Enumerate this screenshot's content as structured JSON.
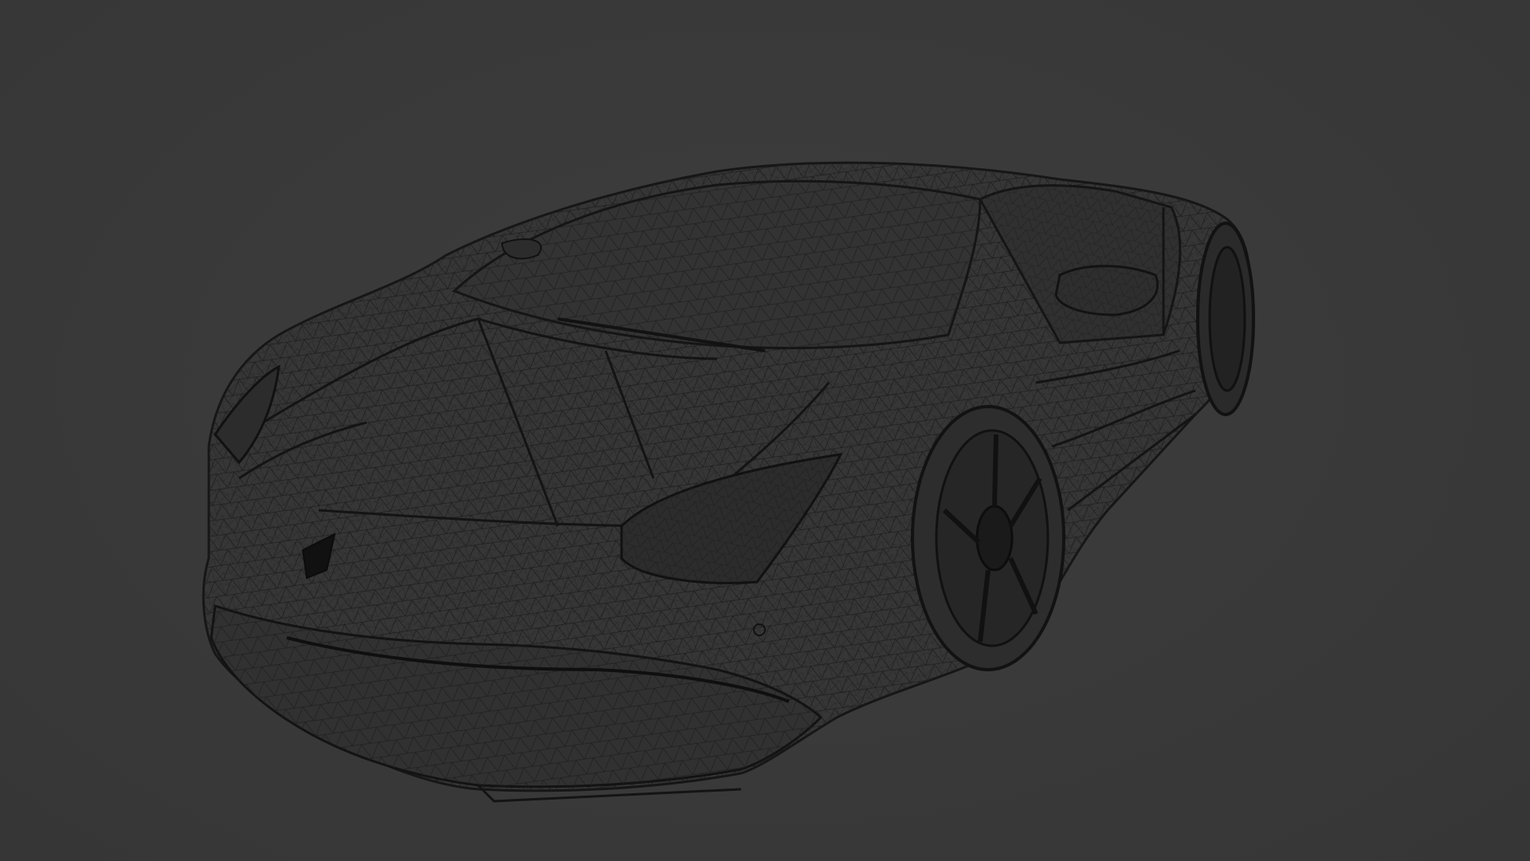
{
  "viewport": {
    "background_color": "#3a3a3a",
    "wire_color": "#1a1a1a",
    "edge_color": "#141414",
    "shade_color": "#2f2f2f",
    "object": "car-wireframe-mesh",
    "view_mode": "wireframe"
  }
}
